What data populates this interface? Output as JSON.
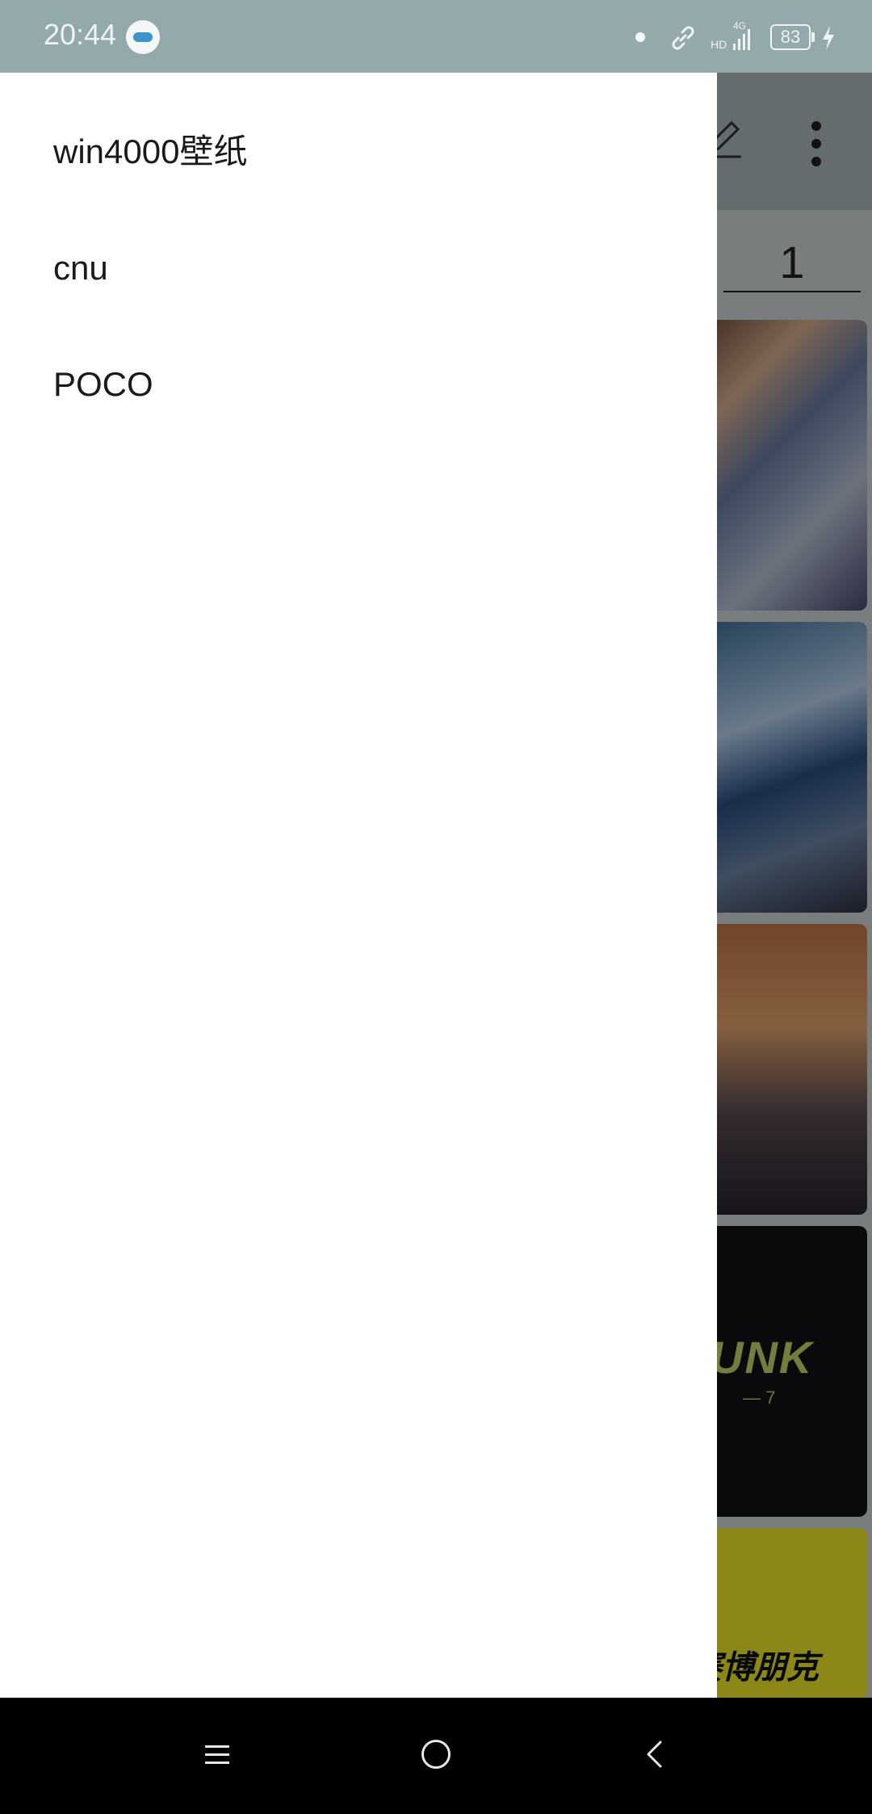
{
  "status_bar": {
    "time": "20:44",
    "battery_level": "83",
    "network_label": "4G",
    "hd_label": "HD",
    "icons": [
      "toggle-icon",
      "dot-icon",
      "link-icon",
      "signal-icon",
      "battery-icon",
      "charging-icon"
    ]
  },
  "drawer": {
    "items": [
      {
        "label": "win4000壁纸"
      },
      {
        "label": "cnu"
      },
      {
        "label": "POCO"
      }
    ]
  },
  "app": {
    "page_number": "1",
    "toolbar_icons": [
      "edit-icon",
      "more-icon"
    ],
    "cards": [
      {
        "image": "anime-character"
      },
      {
        "image": "blue-armor-bird"
      },
      {
        "image": "sunset-landscape"
      },
      {
        "image": "cyberpunk-logo",
        "text": "UNK",
        "subtext": "— 7"
      },
      {
        "image": "yellow-poster",
        "text": "赛博朋克"
      }
    ]
  },
  "nav_bar": {
    "icons": [
      "menu-icon",
      "home-icon",
      "back-icon"
    ]
  },
  "colors": {
    "status_bar_bg": "#93a9ac",
    "drawer_bg": "#ffffff",
    "nav_bar_bg": "#000000"
  }
}
